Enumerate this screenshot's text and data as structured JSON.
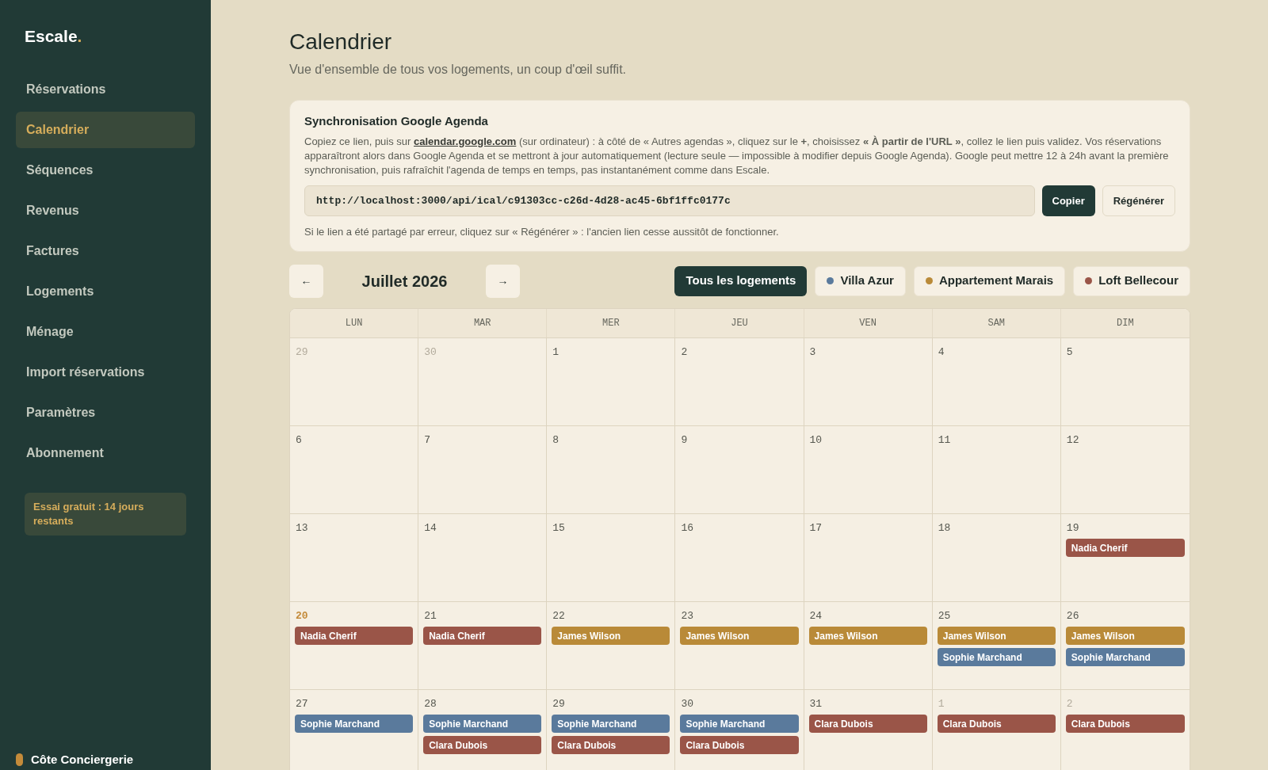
{
  "sidebar": {
    "logo": "Escale",
    "logo_dot": ".",
    "items": [
      {
        "label": "Réservations",
        "selected": false
      },
      {
        "label": "Calendrier",
        "selected": true
      },
      {
        "label": "Séquences",
        "selected": false
      },
      {
        "label": "Revenus",
        "selected": false
      },
      {
        "label": "Factures",
        "selected": false
      },
      {
        "label": "Logements",
        "selected": false
      },
      {
        "label": "Ménage",
        "selected": false
      },
      {
        "label": "Import réservations",
        "selected": false
      },
      {
        "label": "Paramètres",
        "selected": false
      },
      {
        "label": "Abonnement",
        "selected": false
      }
    ],
    "trial": "Essai gratuit : 14 jours restants",
    "account": "Côte Conciergerie"
  },
  "header": {
    "title": "Calendrier",
    "subtitle": "Vue d'ensemble de tous vos logements, un coup d'œil suffit."
  },
  "sync": {
    "title": "Synchronisation Google Agenda",
    "text_before": "Copiez ce lien, puis sur",
    "link": "calendar.google.com",
    "text_after": "(sur ordinateur) : à côté de « Autres agendas », cliquez sur le **+**, choisissez **« À partir de l'URL »**, collez le lien puis validez. Vos réservations apparaîtront alors dans Google Agenda et se mettront à jour automatiquement (lecture seule — impossible à modifier depuis Google Agenda). Google peut mettre 12 à 24h avant la première synchronisation, puis rafraîchit l'agenda de temps en temps, pas instantanément comme dans Escale.",
    "url": "http://localhost:3000/api/ical/c91303cc-c26d-4d28-ac45-6bf1ffc0177c",
    "copy_button": "Copier",
    "regenerate_button": "Régénérer",
    "note": "Si le lien a été partagé par erreur, cliquez sur « Régénérer » : l'ancien lien cesse aussitôt de fonctionner."
  },
  "toolbar": {
    "prev": "←",
    "month": "Juillet 2026",
    "next": "→",
    "filters": [
      {
        "label": "Tous les logements",
        "selected": true
      },
      {
        "label": "Villa Azur",
        "selected": false,
        "color": "#5a7a9c"
      },
      {
        "label": "Appartement Marais",
        "selected": false,
        "color": "#b98a38"
      },
      {
        "label": "Loft Bellecour",
        "selected": false,
        "color": "#9a5548"
      }
    ]
  },
  "calendar": {
    "weekdays": [
      "LUN",
      "MAR",
      "MER",
      "JEU",
      "VEN",
      "SAM",
      "DIM"
    ],
    "days": [
      {
        "day": "29",
        "outside": true,
        "today": false
      },
      {
        "day": "30",
        "outside": true,
        "today": false
      },
      {
        "day": "1",
        "outside": false,
        "today": false
      },
      {
        "day": "2",
        "outside": false,
        "today": false
      },
      {
        "day": "3",
        "outside": false,
        "today": false
      },
      {
        "day": "4",
        "outside": false,
        "today": false
      },
      {
        "day": "5",
        "outside": false,
        "today": false
      },
      {
        "day": "6",
        "outside": false,
        "today": false
      },
      {
        "day": "7",
        "outside": false,
        "today": false
      },
      {
        "day": "8",
        "outside": false,
        "today": false
      },
      {
        "day": "9",
        "outside": false,
        "today": false
      },
      {
        "day": "10",
        "outside": false,
        "today": false
      },
      {
        "day": "11",
        "outside": false,
        "today": false
      },
      {
        "day": "12",
        "outside": false,
        "today": false
      },
      {
        "day": "13",
        "outside": false,
        "today": false
      },
      {
        "day": "14",
        "outside": false,
        "today": false
      },
      {
        "day": "15",
        "outside": false,
        "today": false
      },
      {
        "day": "16",
        "outside": false,
        "today": false
      },
      {
        "day": "17",
        "outside": false,
        "today": false
      },
      {
        "day": "18",
        "outside": false,
        "today": false
      },
      {
        "day": "19",
        "outside": false,
        "today": false,
        "events": [
          {
            "guest": "Nadia Cherif",
            "color": "#9a5548"
          }
        ]
      },
      {
        "day": "20",
        "outside": false,
        "today": true,
        "events": [
          {
            "guest": "Nadia Cherif",
            "color": "#9a5548"
          }
        ]
      },
      {
        "day": "21",
        "outside": false,
        "today": false,
        "events": [
          {
            "guest": "Nadia Cherif",
            "color": "#9a5548"
          }
        ]
      },
      {
        "day": "22",
        "outside": false,
        "today": false,
        "events": [
          {
            "guest": "James Wilson",
            "color": "#b98a38"
          }
        ]
      },
      {
        "day": "23",
        "outside": false,
        "today": false,
        "events": [
          {
            "guest": "James Wilson",
            "color": "#b98a38"
          }
        ]
      },
      {
        "day": "24",
        "outside": false,
        "today": false,
        "events": [
          {
            "guest": "James Wilson",
            "color": "#b98a38"
          }
        ]
      },
      {
        "day": "25",
        "outside": false,
        "today": false,
        "events": [
          {
            "guest": "James Wilson",
            "color": "#b98a38"
          },
          {
            "guest": "Sophie Marchand",
            "color": "#5a7a9c"
          }
        ]
      },
      {
        "day": "26",
        "outside": false,
        "today": false,
        "events": [
          {
            "guest": "James Wilson",
            "color": "#b98a38"
          },
          {
            "guest": "Sophie Marchand",
            "color": "#5a7a9c"
          }
        ]
      },
      {
        "day": "27",
        "outside": false,
        "today": false,
        "events": [
          {
            "guest": "Sophie Marchand",
            "color": "#5a7a9c"
          }
        ]
      },
      {
        "day": "28",
        "outside": false,
        "today": false,
        "events": [
          {
            "guest": "Sophie Marchand",
            "color": "#5a7a9c"
          },
          {
            "guest": "Clara Dubois",
            "color": "#9a5548"
          }
        ]
      },
      {
        "day": "29",
        "outside": false,
        "today": false,
        "events": [
          {
            "guest": "Sophie Marchand",
            "color": "#5a7a9c"
          },
          {
            "guest": "Clara Dubois",
            "color": "#9a5548"
          }
        ]
      },
      {
        "day": "30",
        "outside": false,
        "today": false,
        "events": [
          {
            "guest": "Sophie Marchand",
            "color": "#5a7a9c"
          },
          {
            "guest": "Clara Dubois",
            "color": "#9a5548"
          }
        ]
      },
      {
        "day": "31",
        "outside": false,
        "today": false,
        "events": [
          {
            "guest": "Clara Dubois",
            "color": "#9a5548"
          }
        ]
      },
      {
        "day": "1",
        "outside": true,
        "today": false,
        "events": [
          {
            "guest": "Clara Dubois",
            "color": "#9a5548"
          }
        ]
      },
      {
        "day": "2",
        "outside": true,
        "today": false,
        "events": [
          {
            "guest": "Clara Dubois",
            "color": "#9a5548"
          }
        ]
      }
    ]
  }
}
